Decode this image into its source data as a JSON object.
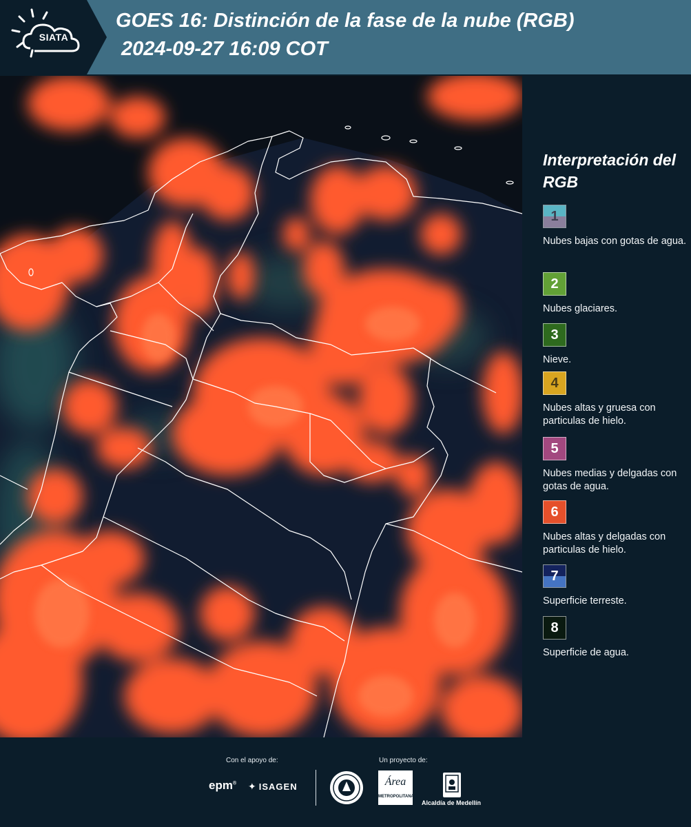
{
  "header": {
    "logo_text": "SIATA",
    "title_line1": "GOES 16: Distinción de la fase de la nube (RGB)",
    "title_line2": "2024-09-27 16:09 COT"
  },
  "legend": {
    "title": "Interpretación del RGB",
    "items": [
      {
        "number": "1",
        "label": "Nubes bajas con gotas de agua.",
        "color_top": "#5ab5c4",
        "color_bottom": "#8a7f9c",
        "number_color": "#3e3e50"
      },
      {
        "number": "2",
        "label": "Nubes glaciares.",
        "color_top": "#62a136",
        "color_bottom": "#62a136",
        "number_color": "#ffffff"
      },
      {
        "number": "3",
        "label": "Nieve.",
        "color_top": "#2e6a1e",
        "color_bottom": "#2e6a1e",
        "number_color": "#ffffff"
      },
      {
        "number": "4",
        "label": "Nubes altas y gruesa con particulas de hielo.",
        "color_top": "#d9a520",
        "color_bottom": "#d9a520",
        "number_color": "#4a3b16"
      },
      {
        "number": "5",
        "label": "Nubes medias y delgadas con gotas de agua.",
        "color_top": "#a2487f",
        "color_bottom": "#a2487f",
        "number_color": "#ffffff"
      },
      {
        "number": "6",
        "label": "Nubes altas y delgadas con particulas de hielo.",
        "color_top": "#e5502b",
        "color_bottom": "#e5502b",
        "number_color": "#ffffff"
      },
      {
        "number": "7",
        "label": "Superficie terreste.",
        "color_top": "#14235e",
        "color_bottom": "#4574c2",
        "number_color": "#ffffff"
      },
      {
        "number": "8",
        "label": "Superficie de agua.",
        "color_top": "#0a1a10",
        "color_bottom": "#0a1a10",
        "number_color": "#ffffff"
      }
    ]
  },
  "footer": {
    "support_label": "Con el apoyo de:",
    "project_label": "Un proyecto de:",
    "epm_logo": "epm",
    "isagen_logo": "ISAGEN",
    "area_logo_big": "Área",
    "area_logo_small": "METROPOLITANA",
    "medellin_label": "Alcaldía de Medellín"
  },
  "colors": {
    "header_bg": "#3f6e84",
    "page_bg": "#0b1d2a",
    "cloud_ice": "#ff5a2e",
    "land": "#0f1a2e",
    "border_lines": "#ffffff"
  }
}
